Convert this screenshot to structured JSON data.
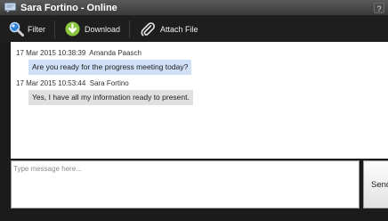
{
  "window": {
    "title": "Sara Fortino - Online",
    "help_label": "?"
  },
  "toolbar": {
    "filter_label": "Filter",
    "download_label": "Download",
    "attach_label": "Attach File"
  },
  "messages": [
    {
      "timestamp": "17 Mar 2015 10:38:39",
      "sender": "Amanda Paasch",
      "text": "Are you ready for the progress meeting today?",
      "bubble_color": "#cfe0f7"
    },
    {
      "timestamp": "17 Mar 2015 10:53:44",
      "sender": "Sara Fortino",
      "text": "Yes, I have all my information ready to present.",
      "bubble_color": "#e0e0e0"
    }
  ],
  "composer": {
    "placeholder": "Type message here...",
    "value": "",
    "send_label": "Send"
  },
  "colors": {
    "titlebar": "#4a4a4a",
    "toolbar": "#1e1e1e",
    "download_icon": "#8cc63f",
    "filter_icon": "#4a90e2"
  }
}
